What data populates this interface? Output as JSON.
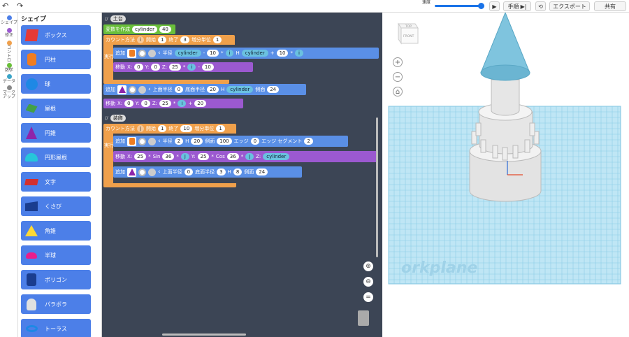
{
  "topbar": {
    "undo_icon": "undo-icon",
    "redo_icon": "redo-icon",
    "speed_label": "速度",
    "step_label": "手順",
    "export_label": "エクスポート",
    "share_label": "共有"
  },
  "categories": [
    {
      "label": "シェイプ",
      "color": "#4c7fe8"
    },
    {
      "label": "修正",
      "color": "#9b59d0"
    },
    {
      "label": "コントロール",
      "color": "#f0a04b"
    },
    {
      "label": "数学",
      "color": "#6abf3a"
    },
    {
      "label": "データ",
      "color": "#3ba5c8"
    },
    {
      "label": "マークアップ",
      "color": "#888888"
    }
  ],
  "palette": {
    "title": "シェイプ",
    "items": [
      {
        "label": "ボックス",
        "icon": "box-icon",
        "color": "#e53935"
      },
      {
        "label": "円柱",
        "icon": "cylinder-icon",
        "color": "#ef7d22"
      },
      {
        "label": "球",
        "icon": "sphere-icon",
        "color": "#1e88e5"
      },
      {
        "label": "屋根",
        "icon": "roof-icon",
        "color": "#43a047"
      },
      {
        "label": "円錐",
        "icon": "cone-icon",
        "color": "#8e24aa"
      },
      {
        "label": "円形屋根",
        "icon": "round-roof-icon",
        "color": "#26c6da"
      },
      {
        "label": "文字",
        "icon": "text-icon",
        "color": "#d32f2f"
      },
      {
        "label": "くさび",
        "icon": "wedge-icon",
        "color": "#1a3d8f"
      },
      {
        "label": "角錐",
        "icon": "pyramid-icon",
        "color": "#fdd835"
      },
      {
        "label": "半球",
        "icon": "half-sphere-icon",
        "color": "#e91e8c"
      },
      {
        "label": "ポリゴン",
        "icon": "polygon-icon",
        "color": "#1a3d8f"
      },
      {
        "label": "パラボラ",
        "icon": "paraboloid-icon",
        "color": "#e0e0e0"
      },
      {
        "label": "トーラス",
        "icon": "torus-icon",
        "color": "#1e88e5"
      }
    ]
  },
  "code": {
    "comment1": "土台",
    "comment2": "装飾",
    "create_var": "変数を作成",
    "var_name": "cylinder",
    "var_value": "40",
    "count_label": "カウント方法",
    "var_i": "i",
    "var_j": "j",
    "start_label": "開始",
    "end_label": "終了",
    "step_label": "増分単位",
    "loop1": {
      "start": "1",
      "end": "3",
      "step": "1"
    },
    "loop2": {
      "start": "1",
      "end": "10",
      "step": "1"
    },
    "do_label": "実行",
    "add_label": "追加",
    "move_label": "移動",
    "radius_label": "半径",
    "height_label": "H",
    "top_radius_label": "上面半径",
    "bottom_radius_label": "底面半径",
    "sides_label": "側面",
    "edge_label": "エッジ",
    "edge_seg_label": "エッジ セグメント",
    "sin_label": "Sin",
    "cos_label": "Cos",
    "op_minus": "-",
    "op_plus": "+",
    "op_mul": "*",
    "b1": {
      "r1": "10",
      "r2": "10",
      "move_z": "25",
      "move_z2": "10"
    },
    "b2": {
      "top": "0",
      "bottom": "20",
      "sides": "24"
    },
    "b3": {
      "x": "0",
      "y": "0",
      "z": "25",
      "z2": "20"
    },
    "b4": {
      "r": "2",
      "h": "20",
      "sides": "100",
      "edge": "0",
      "seg": "2"
    },
    "b5": {
      "x": "25",
      "sin": "36",
      "y": "25",
      "cos": "36"
    },
    "b6": {
      "top": "0",
      "bottom": "3",
      "h": "8",
      "sides": "24"
    },
    "x_label": "X:",
    "y_label": "Y:",
    "z_label": "Z:",
    "zero": "0"
  },
  "viewer": {
    "top_face": "TOP",
    "front_face": "FRONT",
    "workplane_label": "orkplane",
    "colors": {
      "grid": "#a9dcf0",
      "shape": "#e8e8e8",
      "cone": "#7fc4de"
    }
  }
}
